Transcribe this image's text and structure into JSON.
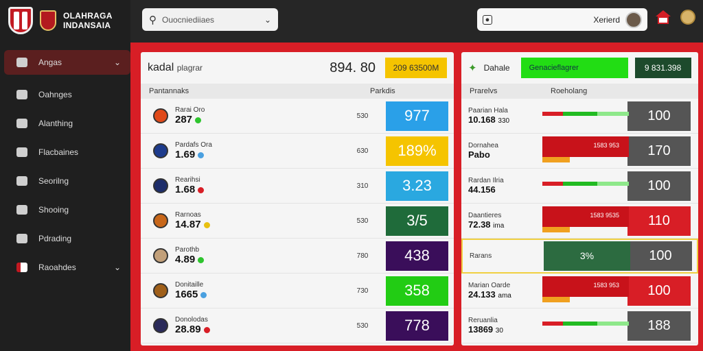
{
  "brand": {
    "line1": "OLAHRAGA",
    "line2": "INDANSAIA"
  },
  "search": {
    "placeholder": "Ouocniediiaes"
  },
  "user": {
    "name": "Xerierd"
  },
  "sidebar": {
    "items": [
      {
        "label": "Angas",
        "active": true,
        "chevron": true,
        "icon": "search-icon"
      },
      {
        "label": "Oahnges",
        "icon": "home-icon"
      },
      {
        "label": "Alanthing",
        "icon": "home-icon"
      },
      {
        "label": "Flacbaines",
        "icon": "people-icon"
      },
      {
        "label": "Seorilng",
        "icon": "card-icon"
      },
      {
        "label": "Shooing",
        "icon": "ball-icon"
      },
      {
        "label": "Pdrading",
        "icon": "printer-icon"
      },
      {
        "label": "Raoahdes",
        "chevron": true,
        "icon": "flag-icon"
      }
    ]
  },
  "left_panel": {
    "title": "kadal",
    "title_sub": "plagrar",
    "total": "894. 80",
    "badge": "209 63500M",
    "col1": "Pantannaks",
    "col2": "Parkdis",
    "rows": [
      {
        "name": "Rarai Oro",
        "val": "287",
        "mid": "530",
        "score": "977",
        "color": "#2aa0e8"
      },
      {
        "name": "Pardafs Ora",
        "val": "1.69",
        "mid": "630",
        "score": "189%",
        "color": "#f5c400"
      },
      {
        "name": "Rearihsi",
        "val": "1.68",
        "mid": "310",
        "score": "3.23",
        "color": "#2aa8e0"
      },
      {
        "name": "Rarnoas",
        "val": "14.87",
        "mid": "530",
        "score": "3/5",
        "color": "#1f6b3a"
      },
      {
        "name": "Parothb",
        "val": "4.89",
        "mid": "780",
        "score": "438",
        "color": "#3a0e5a"
      },
      {
        "name": "Donitaille",
        "val": "1665",
        "mid": "730",
        "score": "358",
        "color": "#22cc14"
      },
      {
        "name": "Donolodas",
        "val": "28.89",
        "mid": "530",
        "score": "778",
        "color": "#3a0e5a"
      }
    ]
  },
  "right_panel": {
    "label": "Dahale",
    "green": "Genacieflagrer",
    "dark": "9 831.398",
    "col1": "Prarelvs",
    "col2": "Roeholang",
    "rows": [
      {
        "name": "Paarian Hala",
        "val": "10.168",
        "suffix": "330",
        "bar": "",
        "num": "100",
        "numColor": "#555",
        "barColor": "green"
      },
      {
        "name": "Dornahea",
        "val": "Pabo",
        "suffix": "",
        "bar": "1583 953",
        "num": "170",
        "numColor": "#555",
        "barColor": "red"
      },
      {
        "name": "Rardan Ilria",
        "val": "44.156",
        "suffix": "",
        "bar": "",
        "num": "100",
        "numColor": "#555",
        "barColor": "green"
      },
      {
        "name": "Daantieres",
        "val": "72.38",
        "suffix": "ima",
        "bar": "1583 9535",
        "num": "110",
        "numColor": "#d81e26",
        "barColor": "red"
      },
      {
        "name": "Rarans",
        "val": "",
        "suffix": "",
        "bar": "3%",
        "num": "100",
        "numColor": "#555",
        "barColor": "dark"
      },
      {
        "name": "Marian Oarde",
        "val": "24.133",
        "suffix": "ama",
        "bar": "1583 953",
        "num": "100",
        "numColor": "#d81e26",
        "barColor": "red"
      },
      {
        "name": "Reruanlia",
        "val": "13869",
        "suffix": "30",
        "bar": "",
        "num": "188",
        "numColor": "#555",
        "barColor": "green"
      }
    ]
  }
}
